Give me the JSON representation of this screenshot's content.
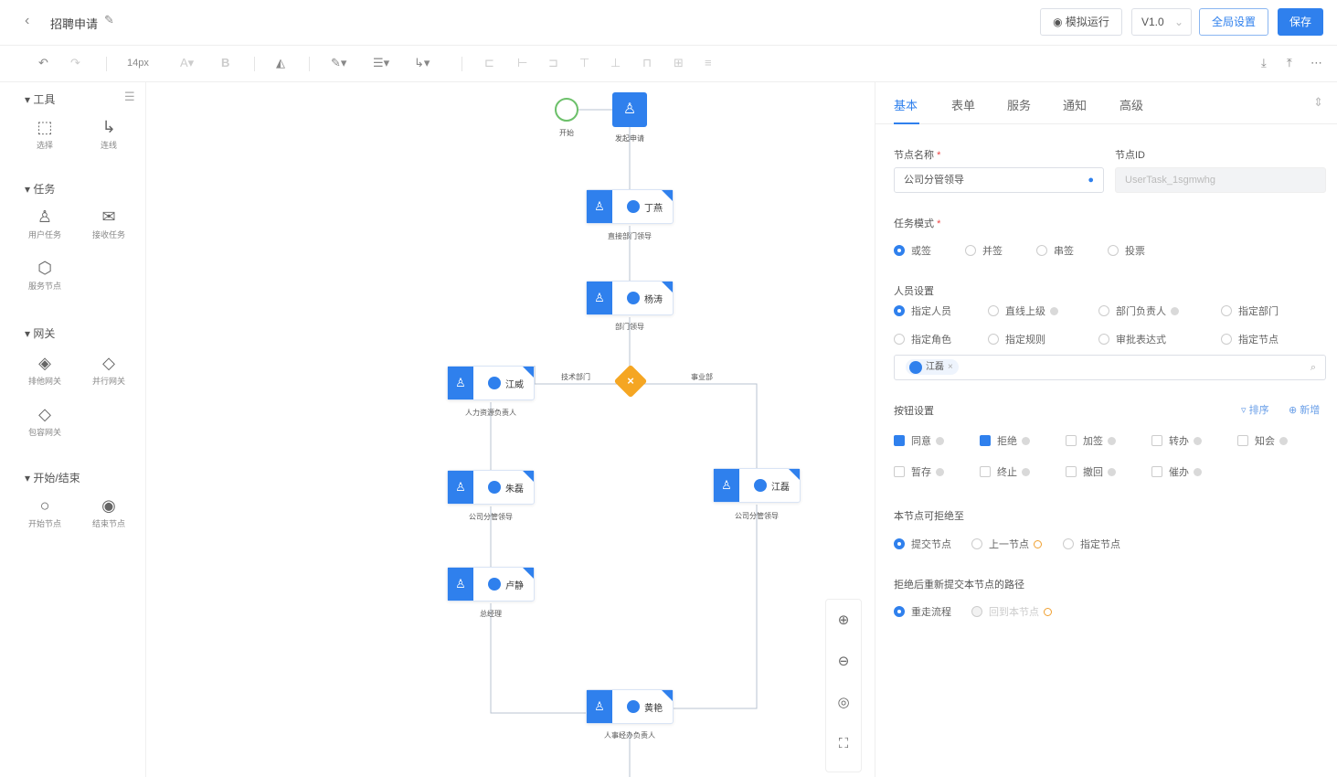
{
  "header": {
    "back_icon": "chevron-left-icon",
    "title": "招聘申请",
    "edit_icon": "pencil-icon",
    "simulate_label": "模拟运行",
    "version": "V1.0",
    "global_settings_label": "全局设置",
    "save_label": "保存"
  },
  "toolbar": {
    "font_size": "14px"
  },
  "palette": {
    "sections": [
      {
        "title": "工具",
        "items": [
          {
            "label": "选择"
          },
          {
            "label": "连线"
          }
        ]
      },
      {
        "title": "任务",
        "items": [
          {
            "label": "用户任务"
          },
          {
            "label": "接收任务"
          },
          {
            "label": "服务节点"
          }
        ]
      },
      {
        "title": "网关",
        "items": [
          {
            "label": "排他网关"
          },
          {
            "label": "并行网关"
          },
          {
            "label": "包容网关"
          }
        ]
      },
      {
        "title": "开始/结束",
        "items": [
          {
            "label": "开始节点"
          },
          {
            "label": "结束节点"
          }
        ]
      }
    ]
  },
  "canvas": {
    "start_label": "开始",
    "first_caption": "发起申请",
    "nodes": [
      {
        "who": "丁燕",
        "caption": "直接部门领导"
      },
      {
        "who": "杨涛",
        "caption": "部门领导"
      },
      {
        "who": "江威",
        "caption": "人力资源负责人"
      },
      {
        "who": "朱磊",
        "caption": "公司分管领导"
      },
      {
        "who": "卢静",
        "caption": "总经理"
      },
      {
        "who": "江磊",
        "caption": "公司分管领导"
      },
      {
        "who": "黄艳",
        "caption": "人事经办负责人"
      }
    ],
    "edge_left": "技术部门",
    "edge_right": "事业部"
  },
  "panel": {
    "tabs": [
      "基本",
      "表单",
      "服务",
      "通知",
      "高级"
    ],
    "node_name_label": "节点名称",
    "node_name_value": "公司分管领导",
    "node_id_label": "节点ID",
    "node_id_value": "UserTask_1sgmwhg",
    "task_mode_label": "任务模式",
    "task_modes": [
      "或签",
      "并签",
      "串签",
      "投票"
    ],
    "person_label": "人员设置",
    "person_options": [
      "指定人员",
      "直线上级",
      "部门负责人",
      "指定部门",
      "指定角色",
      "指定规则",
      "审批表达式",
      "指定节点"
    ],
    "selected_person": "江磊",
    "buttons_label": "按钮设置",
    "sort_label": "排序",
    "add_label": "新增",
    "buttons": [
      "同意",
      "拒绝",
      "加签",
      "转办",
      "知会",
      "暂存",
      "终止",
      "撤回",
      "催办"
    ],
    "reject_to_label": "本节点可拒绝至",
    "reject_to_options": [
      "提交节点",
      "上一节点",
      "指定节点"
    ],
    "resubmit_label": "拒绝后重新提交本节点的路径",
    "resubmit_options": [
      "重走流程",
      "回到本节点"
    ]
  }
}
